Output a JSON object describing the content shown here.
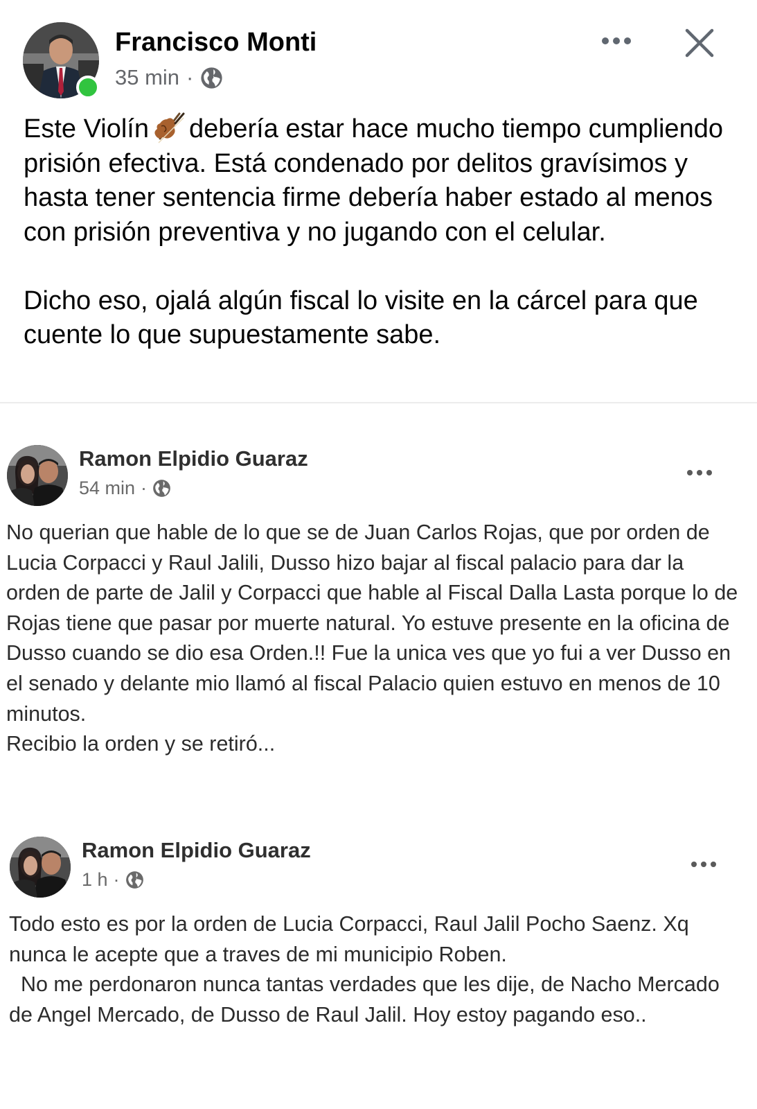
{
  "post": {
    "author": "Francisco Monti",
    "time": "35 min",
    "separator": "·",
    "privacy_icon": "globe-icon",
    "more_icon": "more-horizontal-icon",
    "close_icon": "close-icon",
    "online_color": "#31c43f",
    "text_part1": "Este Violín",
    "emoji": "violin-emoji",
    "text_part2": "debería estar hace mucho tiempo cumpliendo prisión efectiva. Está condenado por delitos gravísimos y hasta tener sentencia firme debería haber estado al menos con prisión preventiva y no jugando con el celular.",
    "text_paragraph2": "Dicho eso, ojalá algún fiscal lo visite en la cárcel para que cuente lo que supuestamente sabe."
  },
  "screenshots": [
    {
      "author": "Ramon Elpidio Guaraz",
      "time": "54 min",
      "separator": "·",
      "paragraphs": [
        "No querian que hable de lo que se de Juan Carlos Rojas,  que por orden de Lucia Corpacci y Raul Jalili, Dusso hizo bajar al fiscal palacio para dar la orden de parte de Jalil y Corpacci que hable al Fiscal Dalla Lasta porque lo de Rojas tiene que pasar por muerte natural. Yo estuve presente en la oficina de Dusso cuando se dio esa Orden.!! Fue la unica ves que yo fui a ver Dusso en el senado y delante mio llamó al fiscal Palacio quien estuvo en menos de 10 minutos.",
        "Recibio la orden y se retiró..."
      ]
    },
    {
      "author": "Ramon Elpidio Guaraz",
      "time": "1 h",
      "separator": "·",
      "paragraphs": [
        "Todo esto es por la orden de Lucia Corpacci, Raul Jalil Pocho Saenz.  Xq nunca le acepte que a traves de mi municipio Roben.",
        "  No me perdonaron nunca tantas verdades que les dije, de Nacho Mercado de Angel Mercado, de Dusso de Raul Jalil. Hoy estoy pagando eso.."
      ]
    }
  ]
}
